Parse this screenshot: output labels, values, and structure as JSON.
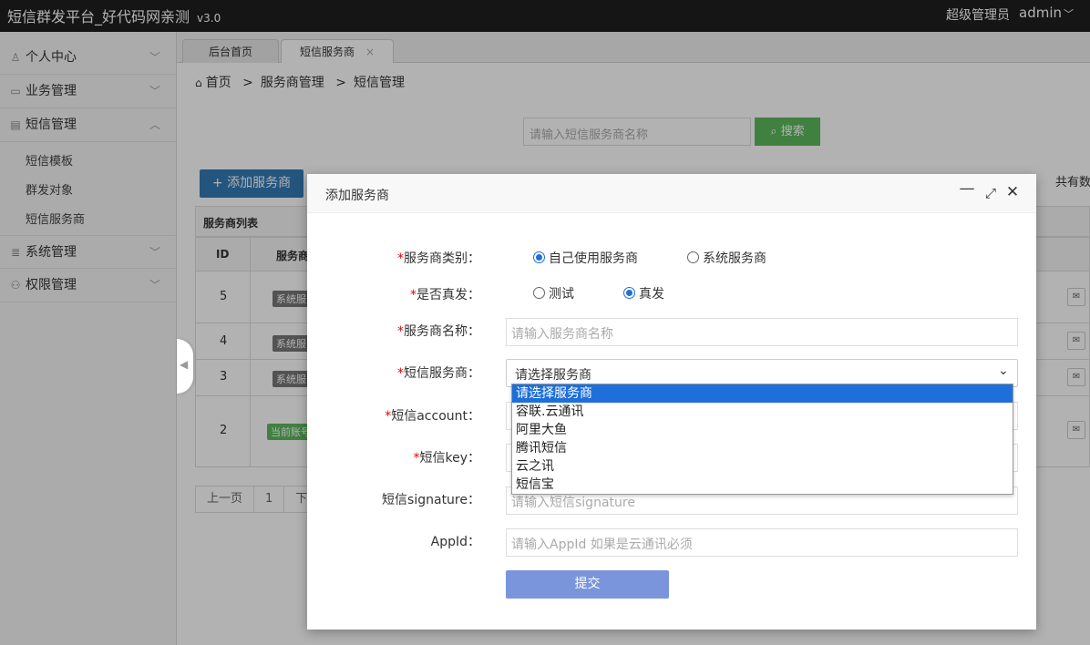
{
  "app": {
    "brand": "短信群发平台_好代码网亲测",
    "version": "v3.0",
    "role": "超级管理员",
    "username": "admin"
  },
  "sidebar": {
    "items": [
      {
        "label": "个人中心",
        "icon": "user-icon"
      },
      {
        "label": "业务管理",
        "icon": "card-icon"
      },
      {
        "label": "短信管理",
        "icon": "book-icon",
        "expanded": true
      },
      {
        "label": "系统管理",
        "icon": "database-icon"
      },
      {
        "label": "权限管理",
        "icon": "users-icon"
      }
    ],
    "sms_sub": [
      "短信模板",
      "群发对象",
      "短信服务商"
    ]
  },
  "tabs": [
    {
      "label": "后台首页"
    },
    {
      "label": "短信服务商",
      "active": true,
      "close": "×"
    }
  ],
  "breadcrumb": {
    "home": "首页",
    "sep": ">",
    "level2": "服务商管理",
    "level3": "短信管理"
  },
  "search": {
    "placeholder": "请输入短信服务商名称",
    "button": "搜索"
  },
  "toolbar": {
    "add_button": "添加服务商",
    "total": "共有数"
  },
  "table": {
    "title": "服务商列表",
    "headers": {
      "id": "ID",
      "name": "服务商"
    },
    "rows": [
      {
        "id": "5",
        "badge": "系统服"
      },
      {
        "id": "4",
        "badge": "系统服"
      },
      {
        "id": "3",
        "badge": "系统服"
      },
      {
        "id": "2",
        "badge": "当前账号"
      }
    ]
  },
  "pager": {
    "prev": "上一页",
    "page": "1",
    "next": "下"
  },
  "modal": {
    "title": "添加服务商",
    "type_label": "服务商类别：",
    "type_options": [
      {
        "label": "自己使用服务商",
        "checked": true
      },
      {
        "label": "系统服务商",
        "checked": false
      }
    ],
    "real_label": "是否真发：",
    "real_options": [
      {
        "label": "测试",
        "checked": false
      },
      {
        "label": "真发",
        "checked": true
      }
    ],
    "name_label": "服务商名称：",
    "name_placeholder": "请输入服务商名称",
    "provider_label": "短信服务商：",
    "provider_value": "请选择服务商",
    "provider_options": [
      "请选择服务商",
      "容联.云通讯",
      "阿里大鱼",
      "腾讯短信",
      "云之讯",
      "短信宝"
    ],
    "account_label": "短信account：",
    "key_label": "短信key：",
    "signature_label": "短信signature：",
    "signature_placeholder": "请输入短信signature",
    "appid_label": "AppId：",
    "appid_placeholder": "请输入AppId  如果是云通讯必须",
    "submit": "提交"
  },
  "colors": {
    "topbar": "#1f1f1f",
    "primary": "#337ab7",
    "search_btn": "#5cb85c",
    "submit_btn": "#7b95dc",
    "required": "#e00000",
    "dropdown_selected": "#1e6fd9"
  }
}
